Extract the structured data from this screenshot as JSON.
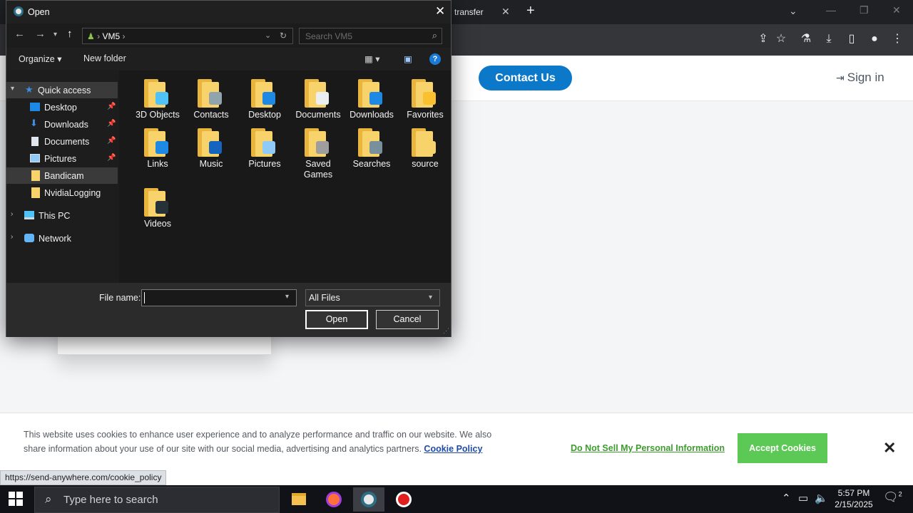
{
  "browser": {
    "tab_title": "transfer",
    "tab_close": "✕",
    "new_tab": "+",
    "tab_search": "⌄",
    "window_minimize": "—",
    "window_restore": "❐",
    "window_close": "✕",
    "toolbar_icons": [
      "share-icon",
      "star-icon",
      "labs-icon",
      "download-icon",
      "sidepanel-icon",
      "profile-icon",
      "menu-icon"
    ]
  },
  "page": {
    "contact_label": "Contact Us",
    "signin_label": "Sign in",
    "accent": "#0c78c9"
  },
  "cookie": {
    "text": "This website uses cookies to enhance user experience and to analyze performance and traffic on our website. We also share information about your use of our site with our social media, advertising and analytics partners.",
    "policy_link": "Cookie Policy",
    "do_not_sell": "Do Not Sell My Personal Information",
    "accept": "Accept Cookies",
    "close": "✕",
    "accept_color": "#5cc855"
  },
  "status_url": "https://send-anywhere.com/cookie_policy",
  "taskbar": {
    "search_placeholder": "Type here to search",
    "time": "5:57 PM",
    "date": "2/15/2025",
    "notifications": "2",
    "apps": [
      "file-explorer",
      "firefox",
      "chrome",
      "record"
    ]
  },
  "dialog": {
    "title": "Open",
    "close": "✕",
    "breadcrumb": "VM5",
    "search_placeholder": "Search VM5",
    "organize": "Organize ▾",
    "new_folder": "New folder",
    "help": "?",
    "tree": [
      {
        "label": "Quick access",
        "icon": "star-icon",
        "pinned": false,
        "selected": true,
        "expanded": true
      },
      {
        "label": "Desktop",
        "icon": "desktop-icon",
        "pinned": true
      },
      {
        "label": "Downloads",
        "icon": "download-arrow-icon",
        "pinned": true
      },
      {
        "label": "Documents",
        "icon": "document-icon",
        "pinned": true
      },
      {
        "label": "Pictures",
        "icon": "pictures-icon",
        "pinned": true
      },
      {
        "label": "Bandicam",
        "icon": "folder-icon",
        "pinned": false,
        "selected": true
      },
      {
        "label": "NvidiaLogging",
        "icon": "folder-icon",
        "pinned": false
      },
      {
        "label": "This PC",
        "icon": "computer-icon",
        "pinned": false
      },
      {
        "label": "Network",
        "icon": "network-icon",
        "pinned": false
      }
    ],
    "folders": [
      {
        "name": "3D Objects",
        "badge": "#4fc3f7"
      },
      {
        "name": "Contacts",
        "badge": "#90a4ae"
      },
      {
        "name": "Desktop",
        "badge": "#1e88e5"
      },
      {
        "name": "Documents",
        "badge": "#eceff1"
      },
      {
        "name": "Downloads",
        "badge": "#1e88e5"
      },
      {
        "name": "Favorites",
        "badge": "#fbc02d"
      },
      {
        "name": "Links",
        "badge": "#1e88e5"
      },
      {
        "name": "Music",
        "badge": "#1565c0"
      },
      {
        "name": "Pictures",
        "badge": "#90caf9"
      },
      {
        "name": "Saved Games",
        "badge": "#9e9e9e"
      },
      {
        "name": "Searches",
        "badge": "#78909c"
      },
      {
        "name": "source",
        "badge": "#f8d36b"
      },
      {
        "name": "Videos",
        "badge": "#263238"
      }
    ],
    "file_name_label": "File name:",
    "file_name_value": "",
    "file_type": "All Files",
    "open_label": "Open",
    "cancel_label": "Cancel"
  }
}
